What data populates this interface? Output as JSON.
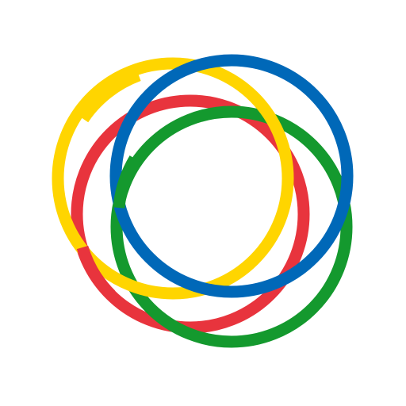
{
  "logo": {
    "rings": [
      {
        "name": "red-ring",
        "color": "#E8343D"
      },
      {
        "name": "green-ring",
        "color": "#14992E"
      },
      {
        "name": "yellow-ring",
        "color": "#FFD500"
      },
      {
        "name": "blue-ring",
        "color": "#0068B8"
      }
    ],
    "background_color": "#FFFFFF"
  }
}
